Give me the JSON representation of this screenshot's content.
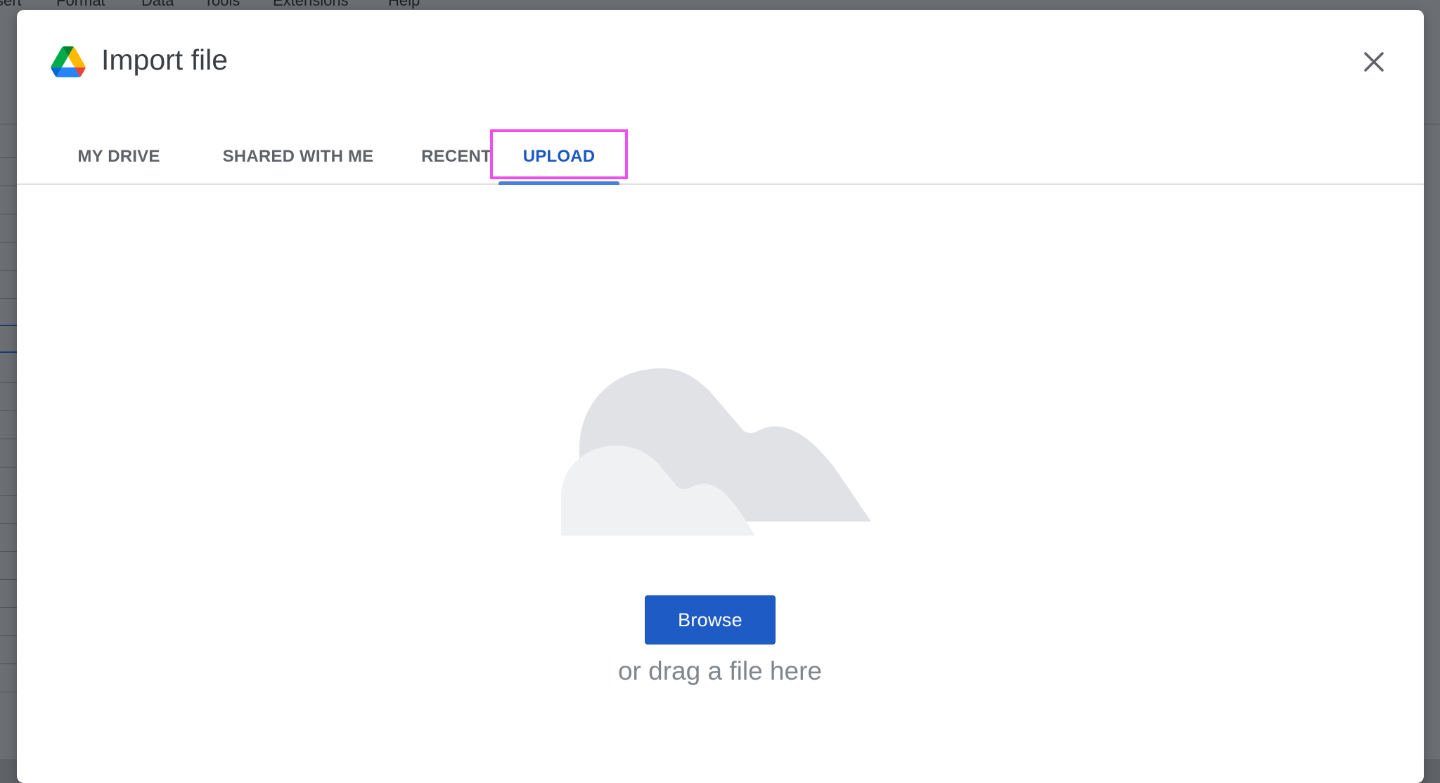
{
  "background_app": {
    "menu_items": [
      "sert",
      "Format",
      "Data",
      "Tools",
      "Extensions",
      "Help"
    ]
  },
  "dialog": {
    "title": "Import file",
    "logo_icon": "google-drive-logo",
    "close_icon": "close-icon",
    "tabs": [
      {
        "label": "MY DRIVE",
        "active": false
      },
      {
        "label": "SHARED WITH ME",
        "active": false
      },
      {
        "label": "RECENT",
        "active": false
      },
      {
        "label": "UPLOAD",
        "active": true,
        "highlighted": true
      }
    ],
    "upload": {
      "illustration_icon": "cloud-illustration",
      "browse_label": "Browse",
      "drag_text": "or drag a file here"
    }
  },
  "colors": {
    "accent": "#1a56c4",
    "tab_underline": "#4a7ee0",
    "highlight_box": "#f04ef0",
    "browse_button": "#1f5bc4",
    "overlay": "#5f6368"
  }
}
